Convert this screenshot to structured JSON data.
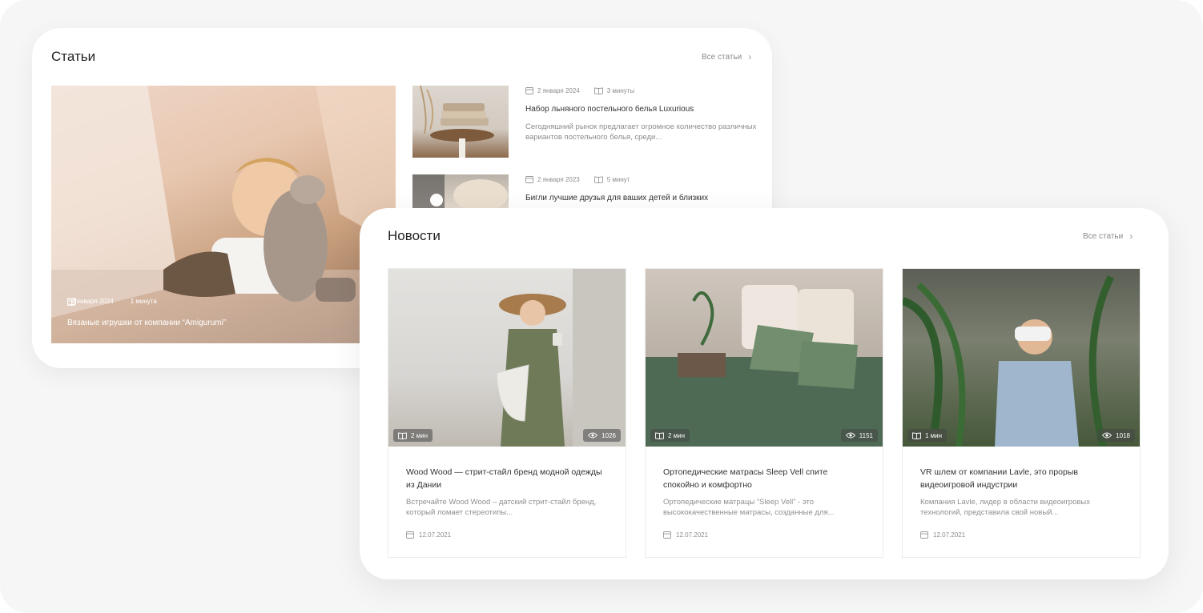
{
  "articles": {
    "title": "Статьи",
    "all_link": "Все статьи",
    "featured": {
      "date": "2 января 2024",
      "read_time": "1 минута",
      "caption": "Вязаные игрушки от компании “Amigurumi”"
    },
    "items": [
      {
        "date": "2 января 2024",
        "read_time": "3 минуты",
        "title": "Набор льняного постельного белья Luxurious",
        "desc": "Сегодняшний рынок предлагает огромное количество различных вариантов постельного белья, среди..."
      },
      {
        "date": "2 января 2023",
        "read_time": "5 минут",
        "title": "Бигли лучшие друзья для ваших детей и близких"
      }
    ]
  },
  "news": {
    "title": "Новости",
    "all_link": "Все статьи",
    "items": [
      {
        "read_time": "2 мин",
        "views": "1026",
        "title": "Wood Wood — стрит-стайл бренд модной одежды из Дании",
        "desc": "Встречайте Wood Wood – датский стрит-стайл бренд, который ломает стереотипы...",
        "date": "12.07.2021"
      },
      {
        "read_time": "2 мин",
        "views": "1151",
        "title": "Ортопедические матрасы Sleep Vell спите спокойно и комфортно",
        "desc": "Ортопедические матрацы “Sleep Vell” - это высококачественные матрасы, созданные для...",
        "date": "12.07.2021"
      },
      {
        "read_time": "1 мин",
        "views": "1018",
        "title": "VR шлем от компании Lavle, это прорыв видеоигровой индустрии",
        "desc": "Компания Lavle, лидер в области видеоигровых технологий, представила свой новый...",
        "date": "12.07.2021"
      }
    ]
  }
}
